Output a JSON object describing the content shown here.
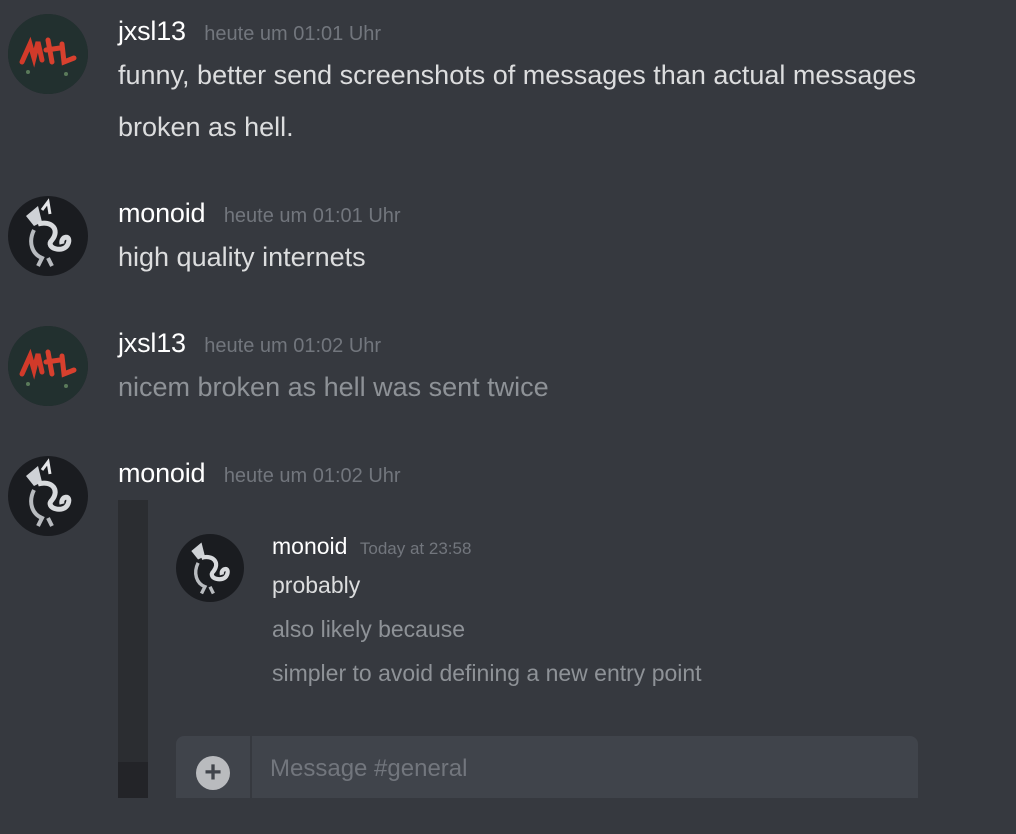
{
  "messages": [
    {
      "author": "jxsl13",
      "timestamp": "heute um 01:01 Uhr",
      "lines": [
        "funny, better send screenshots of messages than actual messages",
        "broken as hell."
      ]
    },
    {
      "author": "monoid",
      "timestamp": "heute um 01:01 Uhr",
      "lines": [
        "high quality internets"
      ]
    },
    {
      "author": "jxsl13",
      "timestamp": "heute um 01:02 Uhr",
      "lines": [
        "nicem broken as hell was sent twice"
      ]
    },
    {
      "author": "monoid",
      "timestamp": "heute um 01:02 Uhr",
      "lines": []
    }
  ],
  "embedded_screenshot": {
    "author": "monoid",
    "timestamp": "Today at 23:58",
    "lines": [
      "probably",
      "also likely because",
      "simpler to avoid defining a new entry point"
    ],
    "composer": {
      "placeholder": "Message #general",
      "plus_icon": "plus-circle-icon"
    }
  },
  "colors": {
    "background": "#36393f",
    "username": "#ffffff",
    "timestamp": "#72767d",
    "text": "#dcddde",
    "muted_text": "#8e9297",
    "composer": "#40444b"
  }
}
